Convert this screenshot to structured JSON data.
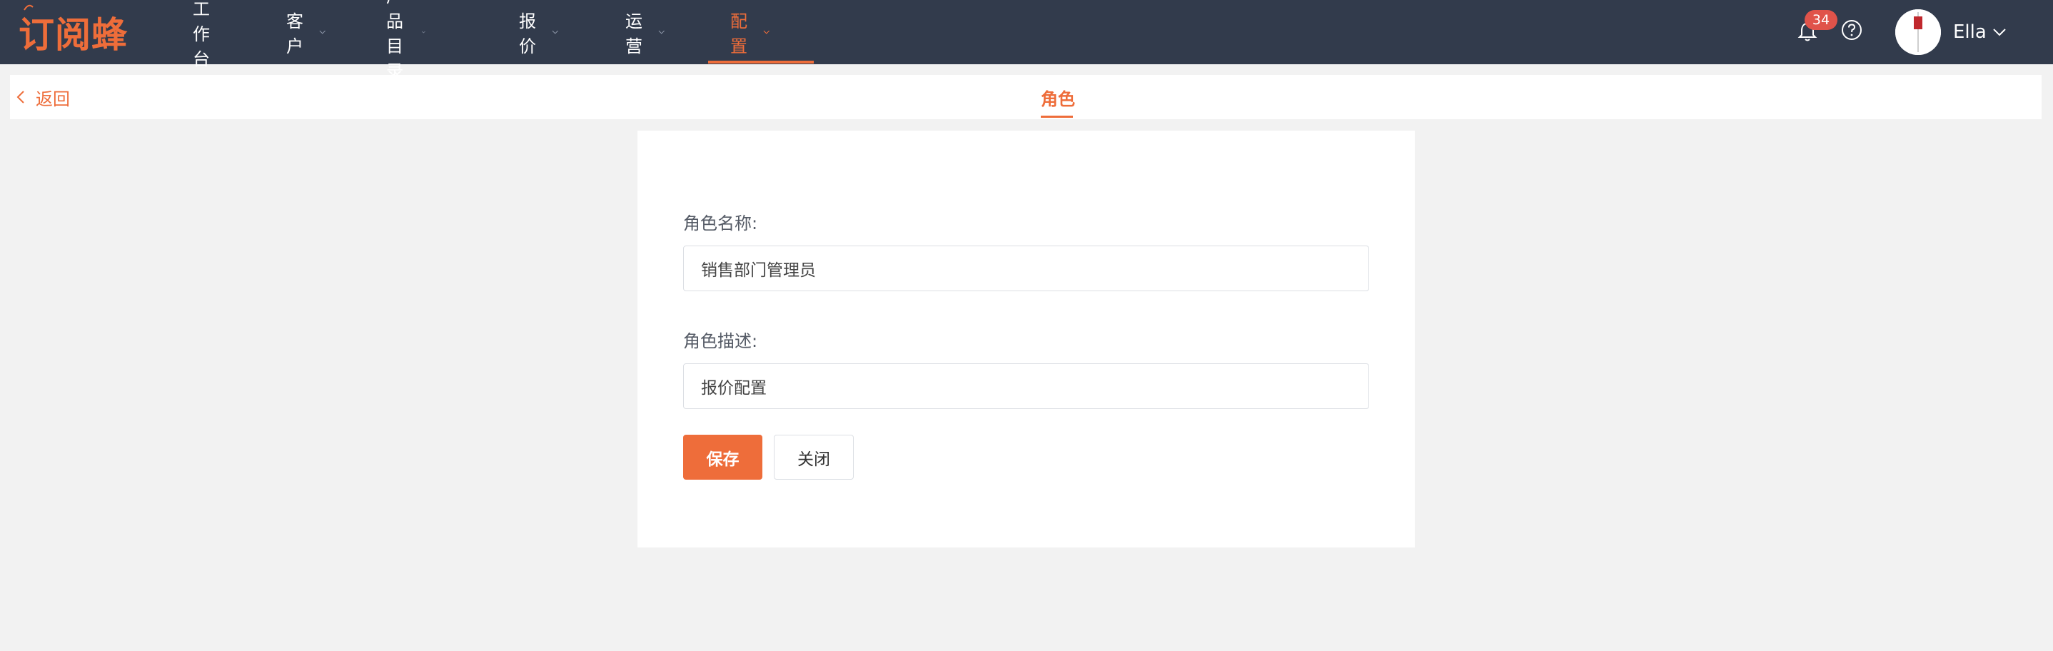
{
  "brand": {
    "logo_text": "订阅蜂",
    "accent": "#ee6d3a",
    "nav_bg": "#323b4c"
  },
  "nav": {
    "items": [
      {
        "label": "工作台",
        "has_dropdown": false
      },
      {
        "label": "客户",
        "has_dropdown": true
      },
      {
        "label": "产品目录",
        "has_dropdown": true
      },
      {
        "label": "报价",
        "has_dropdown": true
      },
      {
        "label": "运营",
        "has_dropdown": true
      },
      {
        "label": "配置",
        "has_dropdown": true,
        "active": true
      }
    ]
  },
  "header_right": {
    "notification_count": "34",
    "notification_icon": "bell-icon",
    "help_icon": "question-circle-icon",
    "user_name": "Ella"
  },
  "subbar": {
    "back_label": "返回",
    "tab_label": "角色"
  },
  "form": {
    "name_label": "角色名称:",
    "name_value": "销售部门管理员",
    "desc_label": "角色描述:",
    "desc_value": "报价配置",
    "save_label": "保存",
    "close_label": "关闭"
  }
}
